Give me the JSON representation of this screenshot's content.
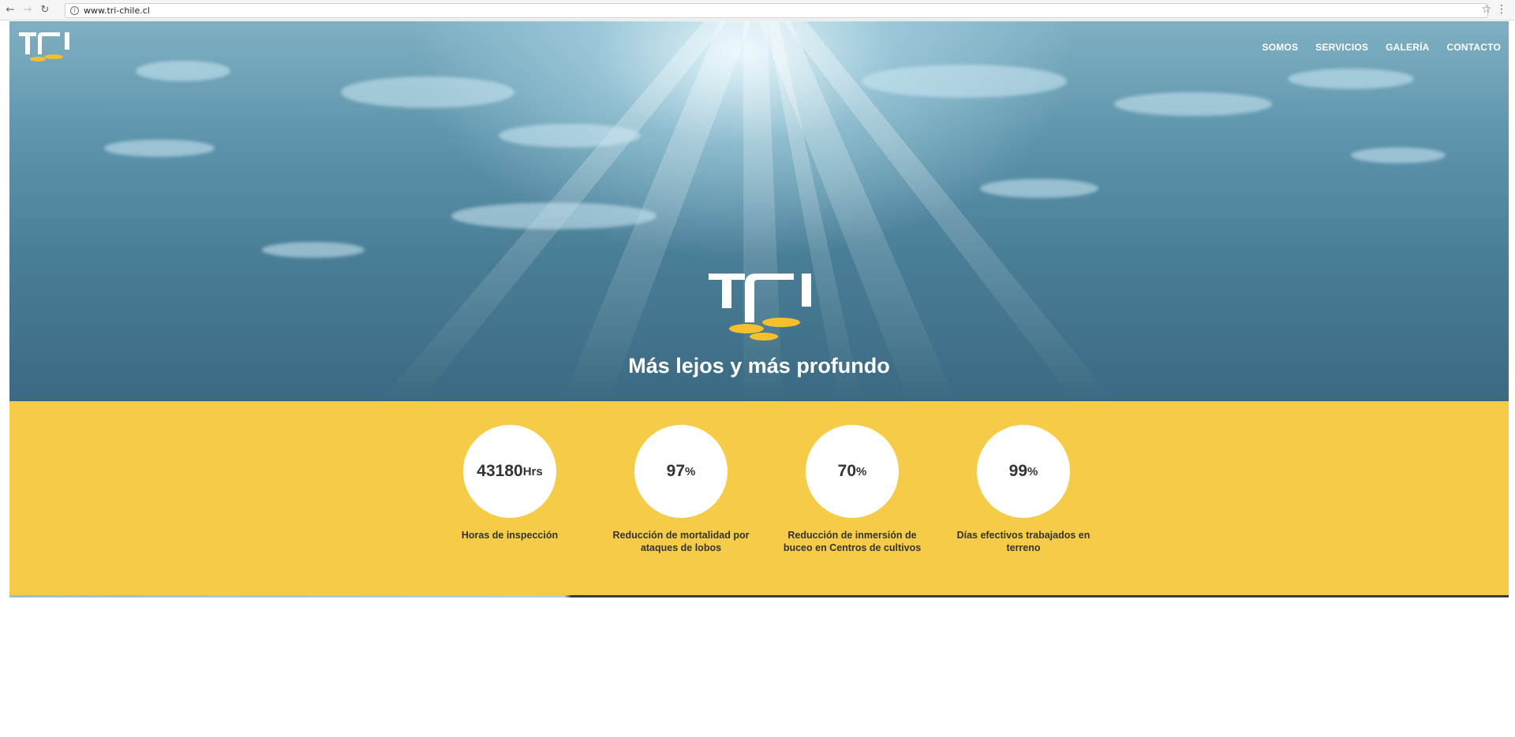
{
  "browser": {
    "url": "www.tri-chile.cl",
    "back_icon": "back-arrow-icon",
    "forward_icon": "forward-arrow-icon",
    "reload_icon": "reload-icon",
    "info_icon": "info-icon",
    "bookmark_icon": "star-icon",
    "menu_icon": "kebab-menu-icon"
  },
  "header": {
    "nav": [
      {
        "label": "SOMOS"
      },
      {
        "label": "SERVICIOS"
      },
      {
        "label": "GALERÍA"
      },
      {
        "label": "CONTACTO"
      }
    ]
  },
  "hero": {
    "tagline": "Más lejos y más profundo"
  },
  "stats": [
    {
      "value": "43180",
      "unit": "Hrs",
      "label": "Horas de inspección"
    },
    {
      "value": "97",
      "unit": "%",
      "label": "Reducción de mortalidad por ataques de lobos"
    },
    {
      "value": "70",
      "unit": "%",
      "label": "Reducción de inmersión de buceo en Centros de cultivos"
    },
    {
      "value": "99",
      "unit": "%",
      "label": "Días efectivos trabajados en terreno"
    }
  ],
  "colors": {
    "accent_yellow": "#f5cb47",
    "text_dark": "#333333",
    "hero_blue": "#4a7f98"
  }
}
